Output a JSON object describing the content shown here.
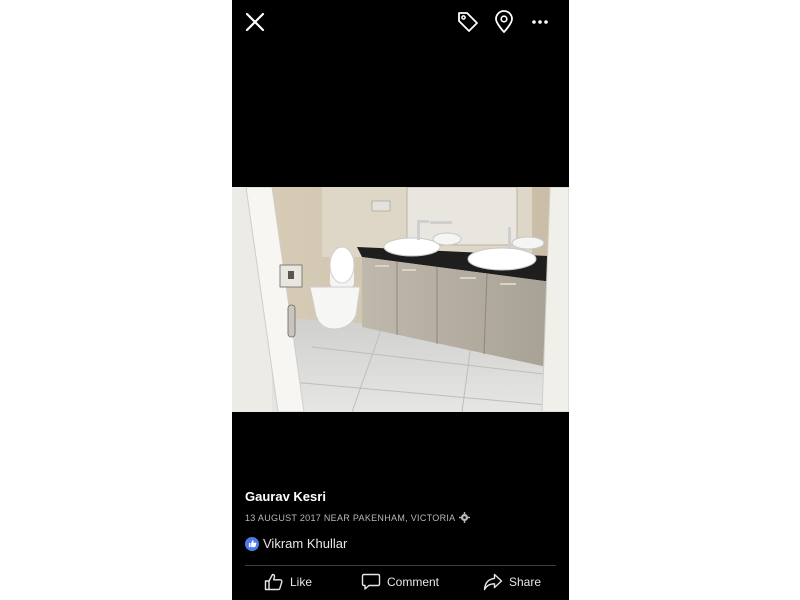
{
  "header": {
    "close_icon": "close-icon",
    "tag_icon": "tag-icon",
    "location_icon": "location-pin-icon",
    "more_icon": "more-options-icon"
  },
  "photo": {
    "subject": "bathroom-vanity-photo"
  },
  "post": {
    "author": "Gaurav Kesri",
    "meta": "13 AUGUST 2017 NEAR PAKENHAM, VICTORIA",
    "privacy_icon": "gear-icon",
    "reaction_name": "Vikram Khullar",
    "reaction_icon": "like-badge-icon"
  },
  "actions": {
    "like": "Like",
    "comment": "Comment",
    "share": "Share"
  },
  "colors": {
    "background": "#000000",
    "like_badge": "#4c7be8",
    "meta_text": "#b8b8b8"
  }
}
